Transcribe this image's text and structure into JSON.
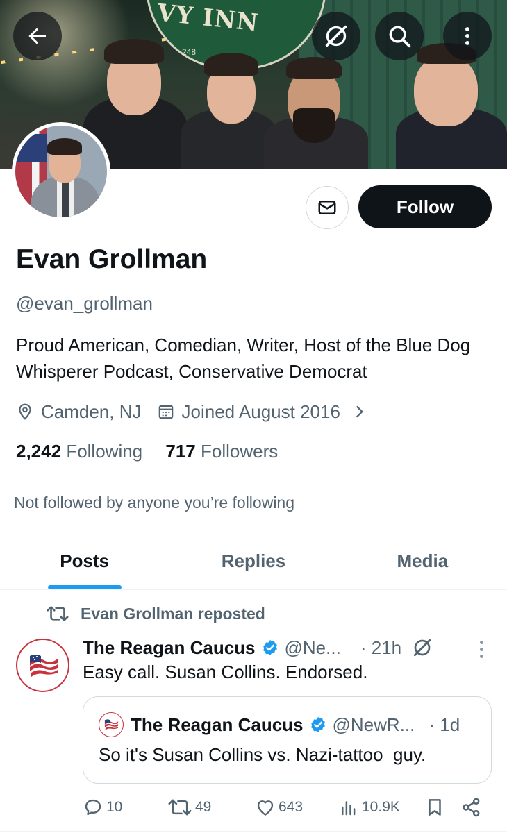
{
  "banner": {
    "sign_text": "VY INN",
    "sign_number": "248"
  },
  "toolbar": {
    "back_icon": "arrow-left-icon",
    "grok_icon": "grok-slash-icon",
    "search_icon": "search-icon",
    "more_icon": "more-vertical-icon"
  },
  "profile": {
    "name": "Evan Grollman",
    "handle": "@evan_grollman",
    "bio": "Proud American, Comedian, Writer, Host of the Blue Dog Whisperer Podcast, Conservative Democrat",
    "location": "Camden, NJ",
    "joined": "Joined August 2016",
    "following_count": "2,242",
    "following_label": "Following",
    "followers_count": "717",
    "followers_label": "Followers",
    "not_followed_text": "Not followed by anyone you’re following",
    "follow_label": "Follow"
  },
  "tabs": [
    {
      "label": "Posts",
      "active": true
    },
    {
      "label": "Replies",
      "active": false
    },
    {
      "label": "Media",
      "active": false
    }
  ],
  "post": {
    "repost_text": "Evan Grollman reposted",
    "author_name": "The Reagan Caucus",
    "author_handle": "@Ne...",
    "time": "· 21h",
    "text": "Easy call. Susan Collins. Endorsed.",
    "quote": {
      "author_name": "The Reagan Caucus",
      "author_handle": "@NewR...",
      "time": "· 1d",
      "text": "So it's Susan Collins vs. Nazi-tattoo  guy."
    },
    "stats": {
      "replies": "10",
      "reposts": "49",
      "likes": "643",
      "views": "10.9K"
    }
  },
  "colors": {
    "accent": "#1d9bf0",
    "text_primary": "#0f1419",
    "text_secondary": "#536471",
    "verified": "#1d9bf0"
  }
}
